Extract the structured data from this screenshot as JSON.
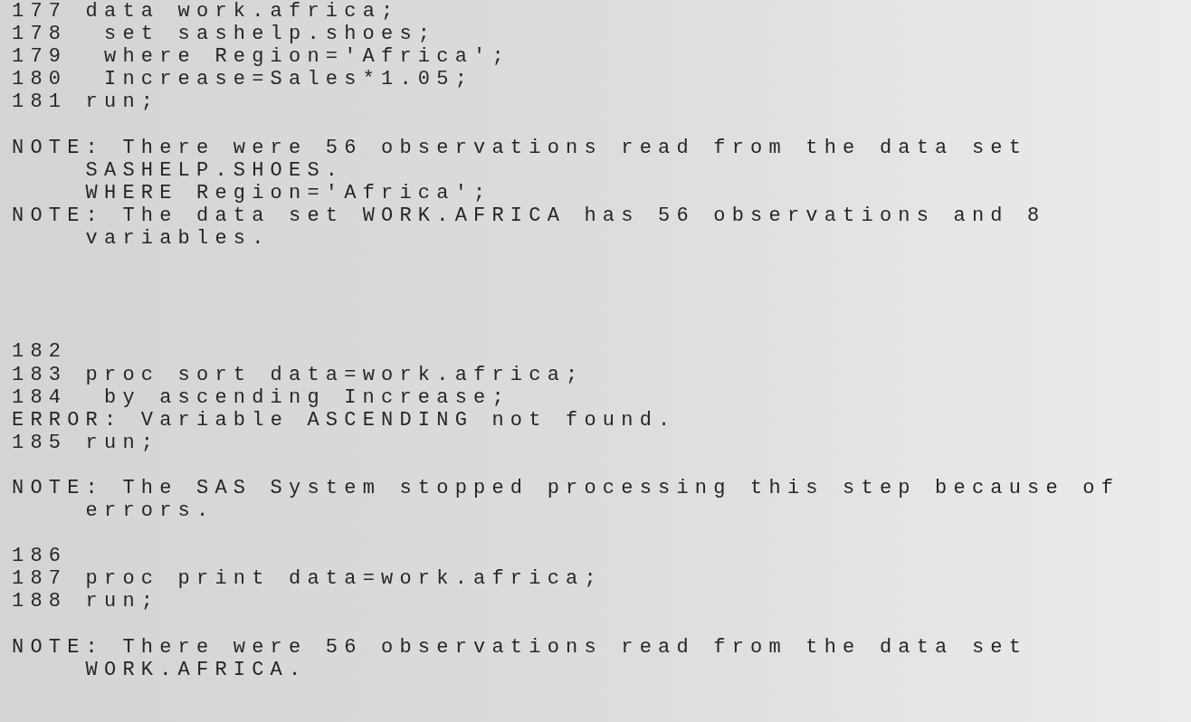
{
  "log": [
    {
      "kind": "code",
      "number": "177",
      "text": "data work.africa;"
    },
    {
      "kind": "nested",
      "number": "178",
      "text": "set sashelp.shoes;"
    },
    {
      "kind": "nested",
      "number": "179",
      "text": "where Region='Africa';"
    },
    {
      "kind": "nested",
      "number": "180",
      "text": "Increase=Sales*1.05;"
    },
    {
      "kind": "code",
      "number": "181",
      "text": "run;"
    },
    {
      "kind": "blank"
    },
    {
      "kind": "message",
      "label": "NOTE:",
      "text": "There were 56 observations read from the data set"
    },
    {
      "kind": "continuation",
      "text": "SASHELP.SHOES."
    },
    {
      "kind": "continuation",
      "text": "WHERE Region='Africa';"
    },
    {
      "kind": "message",
      "label": "NOTE:",
      "text": "The data set WORK.AFRICA has 56 observations and 8"
    },
    {
      "kind": "continuation",
      "text": "variables."
    },
    {
      "kind": "blank"
    },
    {
      "kind": "blank"
    },
    {
      "kind": "blank"
    },
    {
      "kind": "blank"
    },
    {
      "kind": "code",
      "number": "182"
    },
    {
      "kind": "code",
      "number": "183",
      "text": "proc sort data=work.africa;"
    },
    {
      "kind": "nested",
      "number": "184",
      "text": "by ascending Increase;"
    },
    {
      "kind": "message",
      "label": "ERROR:",
      "text": "Variable ASCENDING not found."
    },
    {
      "kind": "code",
      "number": "185",
      "text": "run;"
    },
    {
      "kind": "blank"
    },
    {
      "kind": "message",
      "label": "NOTE:",
      "text": "The SAS System stopped processing this step because of"
    },
    {
      "kind": "continuation",
      "text": "errors."
    },
    {
      "kind": "blank"
    },
    {
      "kind": "code",
      "number": "186"
    },
    {
      "kind": "code",
      "number": "187",
      "text": "proc print data=work.africa;"
    },
    {
      "kind": "code",
      "number": "188",
      "text": "run;"
    },
    {
      "kind": "blank"
    },
    {
      "kind": "message",
      "label": "NOTE:",
      "text": "There were 56 observations read from the data set"
    },
    {
      "kind": "continuation",
      "text": "WORK.AFRICA."
    }
  ]
}
